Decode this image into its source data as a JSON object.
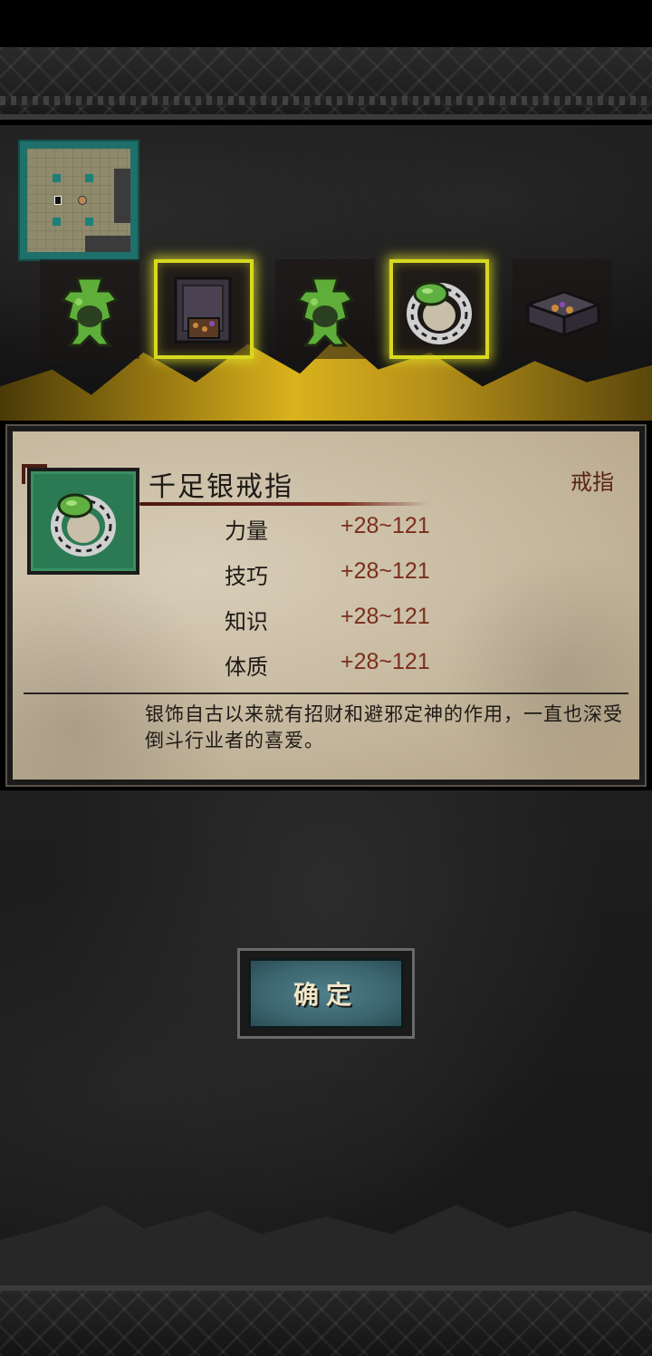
{
  "inventory": {
    "slots": [
      {
        "icon": "jade-incense-burner-icon",
        "selected": false
      },
      {
        "icon": "ancient-cabinet-icon",
        "selected": true
      },
      {
        "icon": "jade-incense-burner-icon",
        "selected": false
      },
      {
        "icon": "silver-jade-ring-icon",
        "selected": true
      },
      {
        "icon": "treasure-chest-icon",
        "selected": false
      }
    ]
  },
  "item_detail": {
    "name": "千足银戒指",
    "type": "戒指",
    "icon": "silver-jade-ring-icon",
    "stats": [
      {
        "label": "力量",
        "value": "+28~121"
      },
      {
        "label": "技巧",
        "value": "+28~121"
      },
      {
        "label": "知识",
        "value": "+28~121"
      },
      {
        "label": "体质",
        "value": "+28~121"
      }
    ],
    "description": "银饰自古以来就有招财和避邪定神的作用，一直也深受倒斗行业者的喜爱。"
  },
  "confirm_button": {
    "label": "确定"
  },
  "colors": {
    "selected_highlight": "#d8d820",
    "panel_paper": "#c9bca2",
    "stat_value": "#7a2e1c",
    "item_type": "#5a231a",
    "button_teal": "#3c6670"
  }
}
